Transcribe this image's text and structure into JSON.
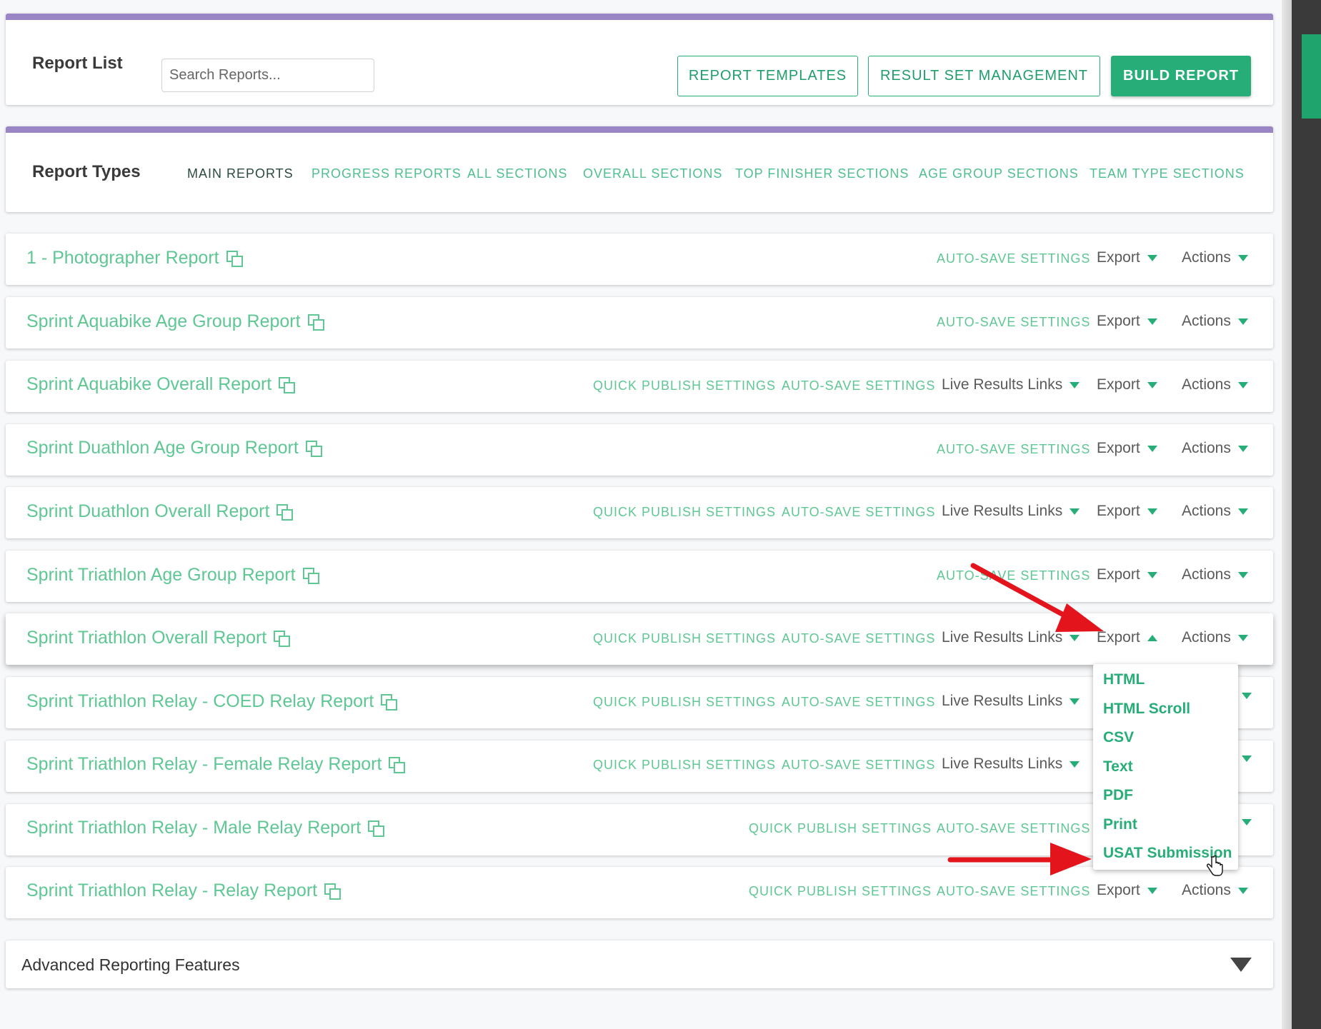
{
  "header": {
    "title": "Report List",
    "search_placeholder": "Search Reports...",
    "buttons": {
      "templates": "REPORT TEMPLATES",
      "result_sets": "RESULT SET MANAGEMENT",
      "build": "BUILD REPORT"
    }
  },
  "types": {
    "title": "Report Types",
    "tabs": [
      "MAIN REPORTS",
      "PROGRESS REPORTS",
      "ALL SECTIONS",
      "OVERALL SECTIONS",
      "TOP FINISHER SECTIONS",
      "AGE GROUP SECTIONS",
      "TEAM TYPE SECTIONS"
    ]
  },
  "labels": {
    "quick_publish": "QUICK PUBLISH SETTINGS",
    "auto_save": "AUTO-SAVE SETTINGS",
    "live_links": "Live Results Links",
    "export": "Export",
    "actions": "Actions"
  },
  "reports": [
    "1 - Photographer Report",
    "Sprint Aquabike Age Group Report",
    "Sprint Aquabike Overall Report",
    "Sprint Duathlon Age Group Report",
    "Sprint Duathlon Overall Report",
    "Sprint Triathlon Age Group Report",
    "Sprint Triathlon Overall Report",
    "Sprint Triathlon Relay - COED Relay Report",
    "Sprint Triathlon Relay - Female Relay Report",
    "Sprint Triathlon Relay - Male Relay Report",
    "Sprint Triathlon Relay - Relay Report"
  ],
  "export_menu": [
    "HTML",
    "HTML Scroll",
    "CSV",
    "Text",
    "PDF",
    "Print",
    "USAT Submission"
  ],
  "advanced": {
    "title": "Advanced Reporting Features"
  },
  "colors": {
    "accent": "#27ae78",
    "link": "#5ec794",
    "purple_bar": "#9a86c5",
    "annotation": "#e3141b"
  }
}
